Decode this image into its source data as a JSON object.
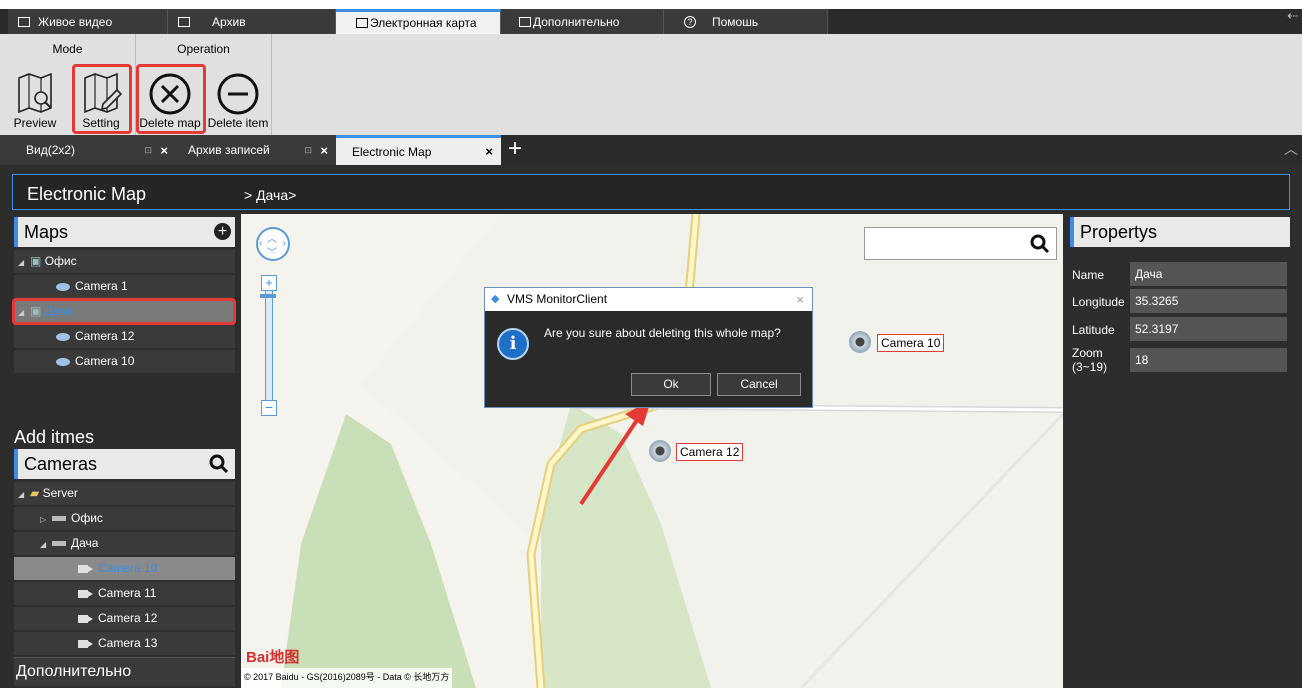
{
  "top_tabs": [
    {
      "label": "Живое видео"
    },
    {
      "label": "Архив"
    },
    {
      "label": "Электронная карта"
    },
    {
      "label": "Дополнительно"
    },
    {
      "label": "Помошь"
    }
  ],
  "ribbon": {
    "mode_header": "Mode",
    "operation_header": "Operation",
    "buttons": {
      "preview": "Preview",
      "setting": "Setting",
      "delete_map": "Delete map",
      "delete_item": "Delete item"
    }
  },
  "view_tabs": [
    {
      "label": "Вид(2x2)"
    },
    {
      "label": "Архив записей"
    },
    {
      "label": "Electronic Map"
    }
  ],
  "breadcrumb": {
    "title": "Electronic Map",
    "path": "> Дача>"
  },
  "maps": {
    "header": "Maps",
    "items": [
      {
        "label": "Офис"
      },
      {
        "label": "Camera 1"
      },
      {
        "label": "Дача"
      },
      {
        "label": "Camera 12"
      },
      {
        "label": "Camera 10"
      }
    ]
  },
  "add_items": {
    "title": "Add itmes",
    "cameras_header": "Cameras",
    "tree": [
      {
        "label": "Server"
      },
      {
        "label": "Офис"
      },
      {
        "label": "Дача"
      },
      {
        "label": "Camera 10"
      },
      {
        "label": "Camera 11"
      },
      {
        "label": "Camera 12"
      },
      {
        "label": "Camera 13"
      }
    ],
    "more": "Дополнительно"
  },
  "map": {
    "camera_markers": [
      {
        "label": "Camera 10"
      },
      {
        "label": "Camera 12"
      }
    ],
    "copyright": "© 2017 Baidu - GS(2016)2089号 - Data © 长地万方",
    "logo": "Bai地图"
  },
  "properties": {
    "header": "Propertys",
    "fields": [
      {
        "label": "Name",
        "value": "Дача"
      },
      {
        "label": "Longitude",
        "value": "35.3265"
      },
      {
        "label": "Latitude",
        "value": "52.3197"
      },
      {
        "label": "Zoom",
        "label2": "(3~19)",
        "value": "18"
      }
    ]
  },
  "dialog": {
    "title": "VMS MonitorClient",
    "message": "Are you sure about deleting this whole map?",
    "ok": "Ok",
    "cancel": "Cancel"
  },
  "colors": {
    "accent": "#3d8ee6",
    "highlight": "#e53935",
    "selected_text": "#3d8ee6"
  }
}
